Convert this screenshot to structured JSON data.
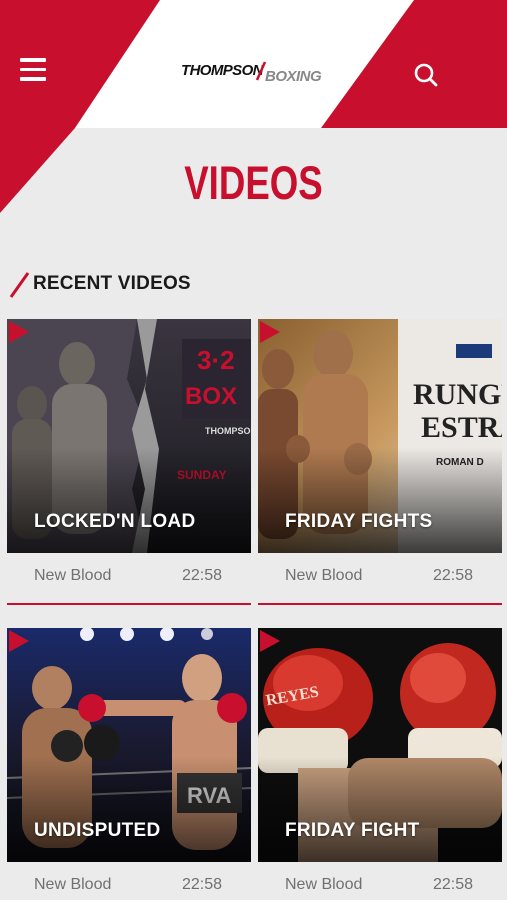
{
  "header": {
    "logo_part1": "THOMPSON",
    "logo_part2": "BOXING",
    "menu_icon": "hamburger-menu-icon",
    "search_icon": "search-icon"
  },
  "page": {
    "title": "VIDEOS"
  },
  "section": {
    "title": "RECENT VIDEOS"
  },
  "videos": [
    {
      "title": "LOCKED'N LOAD",
      "category": "New Blood",
      "duration": "22:58"
    },
    {
      "title": "FRIDAY FIGHTS",
      "category": "New Blood",
      "duration": "22:58"
    },
    {
      "title": "UNDISPUTED",
      "category": "New Blood",
      "duration": "22:58"
    },
    {
      "title": "FRIDAY FIGHT",
      "category": "New Blood",
      "duration": "22:58"
    }
  ],
  "colors": {
    "accent": "#c8102e",
    "background": "#ebebeb",
    "meta_text": "#707070"
  }
}
